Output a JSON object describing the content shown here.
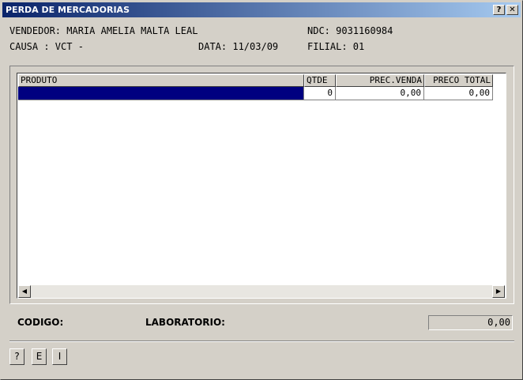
{
  "window": {
    "title": "PERDA DE MERCADORIAS",
    "help_button": "?",
    "close_button": "✕"
  },
  "header": {
    "vendedor": "VENDEDOR: MARIA AMELIA MALTA LEAL",
    "ndc": "NDC: 9031160984",
    "causa": "CAUSA : VCT -",
    "data": "DATA: 11/03/09",
    "filial": "FILIAL: 01"
  },
  "grid": {
    "columns": [
      "PRODUTO",
      "QTDE",
      "PREC.VENDA",
      "PRECO TOTAL"
    ],
    "rows": [
      {
        "produto": "",
        "qtde": "0",
        "prec_venda": "0,00",
        "preco_total": "0,00"
      }
    ],
    "selected_color": "#000080"
  },
  "scrollbar": {
    "left_icon": "◀",
    "right_icon": "▶"
  },
  "footer": {
    "codigo_label": "CODIGO:",
    "laboratorio_label": "LABORATORIO:",
    "total_value": "0,00"
  },
  "buttons": {
    "help": "?",
    "e": "E",
    "i": "I"
  }
}
